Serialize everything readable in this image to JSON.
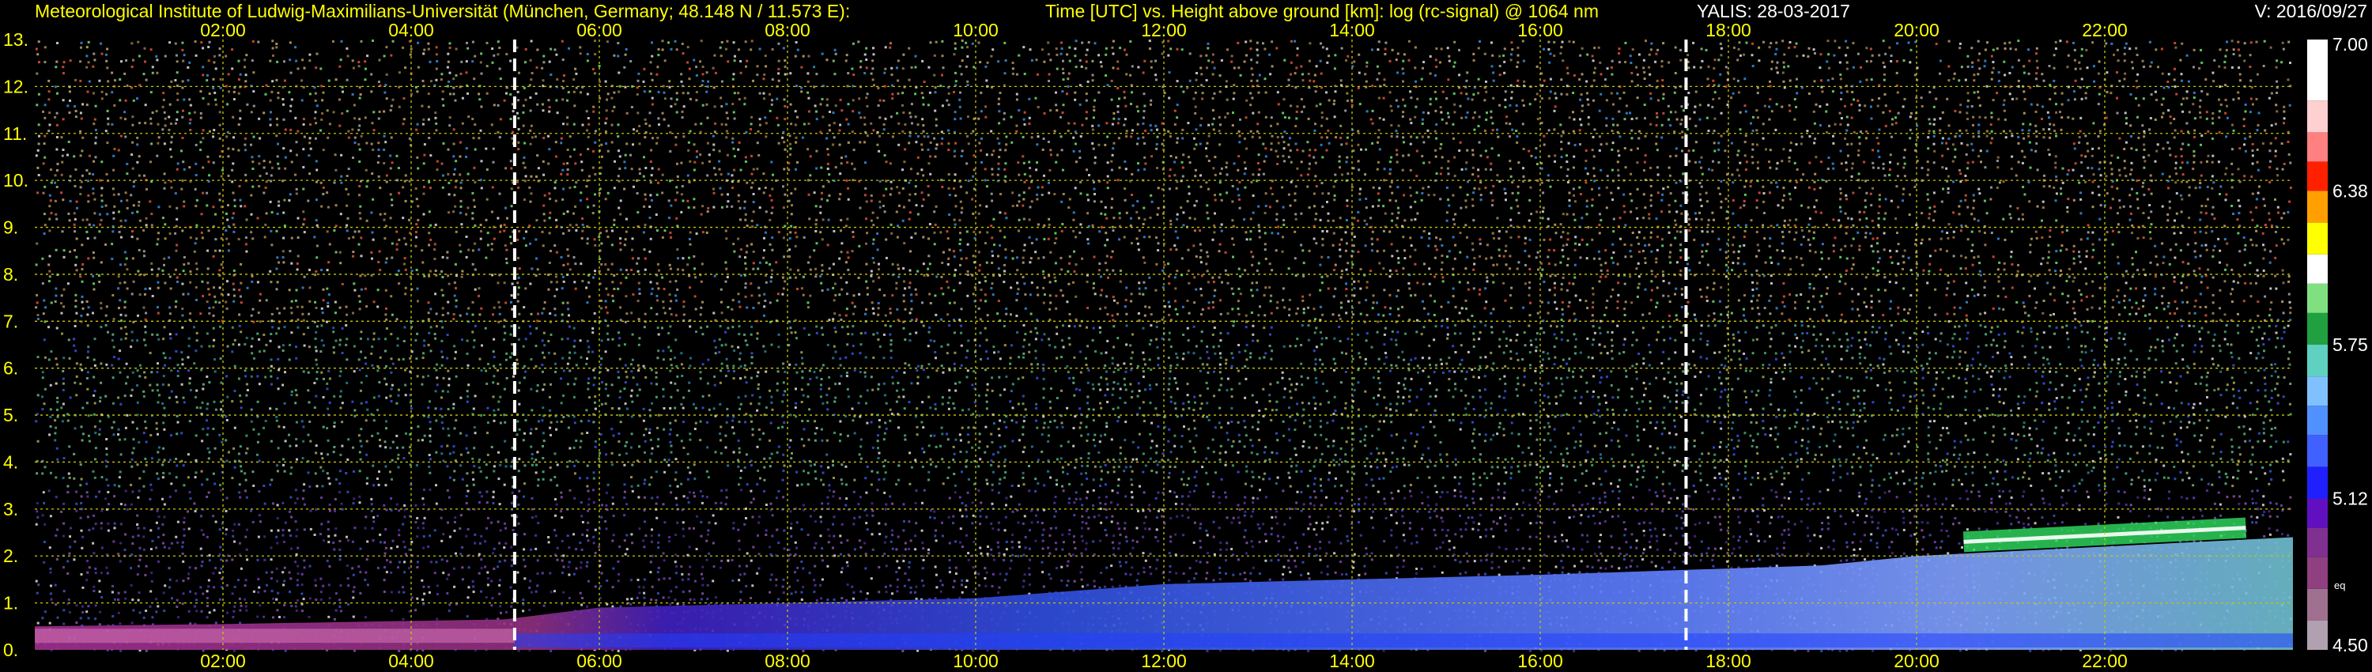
{
  "header": {
    "institute": "Meteorological Institute of Ludwig-Maximilians-Universität (München, Germany; 48.148 N / 11.573 E):",
    "axes_desc": "Time [UTC] vs. Height above ground [km]: log (rc-signal) @ 1064 nm",
    "station_date": "YALIS: 28-03-2017",
    "version": "V: 2016/09/27"
  },
  "chart_data": {
    "type": "heatmap",
    "title": "Time [UTC] vs. Height above ground [km]: log (rc-signal) @ 1064 nm",
    "xlabel": "Time [UTC]",
    "ylabel": "Height above ground [km]",
    "xlim": [
      "00:00",
      "24:00"
    ],
    "ylim": [
      0,
      13
    ],
    "x_ticks": [
      "02:00",
      "04:00",
      "06:00",
      "08:00",
      "10:00",
      "12:00",
      "14:00",
      "16:00",
      "18:00",
      "20:00",
      "22:00"
    ],
    "x_tick_hours": [
      2,
      4,
      6,
      8,
      10,
      12,
      14,
      16,
      18,
      20,
      22
    ],
    "y_ticks": [
      0,
      1,
      2,
      3,
      4,
      5,
      6,
      7,
      8,
      9,
      10,
      11,
      12,
      13
    ],
    "y_tick_labels": [
      "0.",
      "1.",
      "2.",
      "3.",
      "4.",
      "5.",
      "6.",
      "7.",
      "8.",
      "9.",
      "10.",
      "11.",
      "12.",
      "13."
    ],
    "grid": true,
    "markers_hours": [
      5.1,
      17.55
    ],
    "colorbar": {
      "range": [
        4.5,
        7.0
      ],
      "labels": [
        "7.00",
        "6.38",
        "5.75",
        "5.12",
        "4.50"
      ],
      "label_values": [
        7.0,
        6.38,
        5.75,
        5.12,
        4.5
      ],
      "side_label": "eq"
    },
    "layers": [
      {
        "name": "boundary_layer_top_km",
        "x_hours": [
          0,
          2,
          5,
          6,
          8,
          10,
          12,
          14,
          16,
          17.5,
          19,
          20,
          21,
          22,
          23,
          24
        ],
        "values": [
          0.5,
          0.55,
          0.65,
          0.9,
          1.0,
          1.1,
          1.4,
          1.5,
          1.6,
          1.7,
          1.8,
          2.0,
          2.1,
          2.2,
          2.3,
          2.4
        ]
      },
      {
        "name": "cloud_layer_km",
        "x_hours": [
          20.5,
          21.5,
          22.5,
          23.5
        ],
        "values": [
          2.3,
          2.4,
          2.5,
          2.6
        ]
      }
    ]
  }
}
